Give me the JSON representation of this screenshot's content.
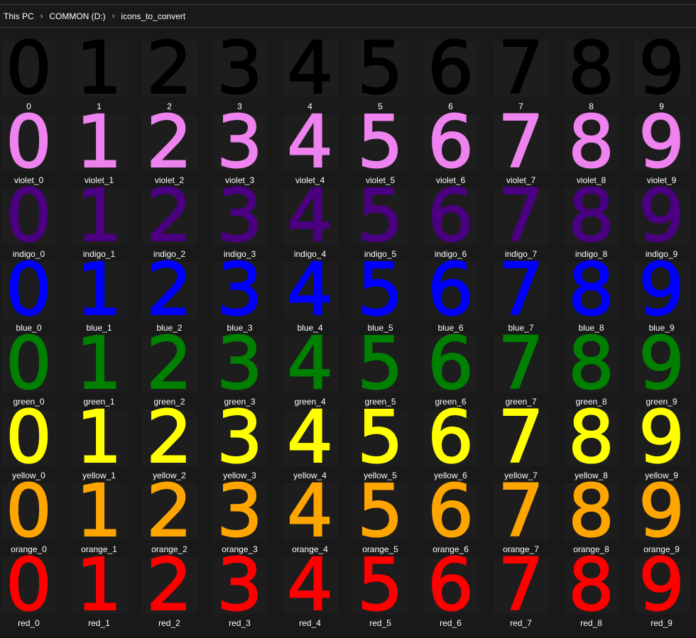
{
  "breadcrumb": [
    "This PC",
    "COMMON (D:)",
    "icons_to_convert"
  ],
  "breadcrumb_separator": "›",
  "digits": [
    "0",
    "1",
    "2",
    "3",
    "4",
    "5",
    "6",
    "7",
    "8",
    "9"
  ],
  "rows": [
    {
      "prefix": "",
      "color": "#000000"
    },
    {
      "prefix": "violet_",
      "color": "#ee82ee"
    },
    {
      "prefix": "indigo_",
      "color": "#4b0082"
    },
    {
      "prefix": "blue_",
      "color": "#0000ff"
    },
    {
      "prefix": "green_",
      "color": "#008000"
    },
    {
      "prefix": "yellow_",
      "color": "#ffff00"
    },
    {
      "prefix": "orange_",
      "color": "#ffa500"
    },
    {
      "prefix": "red_",
      "color": "#ff0000"
    }
  ],
  "files": []
}
